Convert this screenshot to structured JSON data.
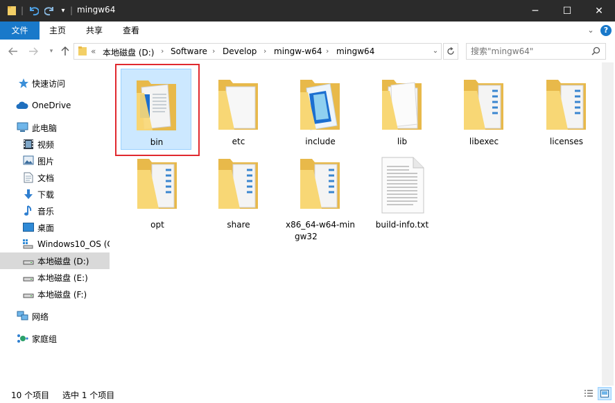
{
  "window": {
    "title": "mingw64",
    "buttons": {
      "minimize": "─",
      "maximize": "☐",
      "close": "✕"
    }
  },
  "ribbon": {
    "tabs": [
      {
        "label": "文件"
      },
      {
        "label": "主页"
      },
      {
        "label": "共享"
      },
      {
        "label": "查看"
      }
    ],
    "help_glyph": "?"
  },
  "address": {
    "prefix": "«",
    "crumbs": [
      "本地磁盘 (D:)",
      "Software",
      "Develop",
      "mingw-w64",
      "mingw64"
    ],
    "separator": "›"
  },
  "search": {
    "placeholder": "搜索\"mingw64\""
  },
  "sidebar": {
    "items": [
      {
        "label": "快速访问",
        "icon": "star-icon"
      },
      {
        "label": "OneDrive",
        "icon": "cloud-icon"
      },
      {
        "label": "此电脑",
        "icon": "computer-icon"
      },
      {
        "label": "视频",
        "icon": "video-icon"
      },
      {
        "label": "图片",
        "icon": "picture-icon"
      },
      {
        "label": "文档",
        "icon": "document-icon"
      },
      {
        "label": "下载",
        "icon": "download-icon"
      },
      {
        "label": "音乐",
        "icon": "music-icon"
      },
      {
        "label": "桌面",
        "icon": "desktop-icon"
      },
      {
        "label": "Windows10_OS (C",
        "icon": "drive-os-icon"
      },
      {
        "label": "本地磁盘 (D:)",
        "icon": "drive-icon"
      },
      {
        "label": "本地磁盘 (E:)",
        "icon": "drive-icon"
      },
      {
        "label": "本地磁盘 (F:)",
        "icon": "drive-icon"
      },
      {
        "label": "网络",
        "icon": "network-icon"
      },
      {
        "label": "家庭组",
        "icon": "homegroup-icon"
      }
    ]
  },
  "files": [
    {
      "name": "bin",
      "type": "folder",
      "selected": true
    },
    {
      "name": "etc",
      "type": "folder"
    },
    {
      "name": "include",
      "type": "folder"
    },
    {
      "name": "lib",
      "type": "folder"
    },
    {
      "name": "libexec",
      "type": "folder"
    },
    {
      "name": "licenses",
      "type": "folder"
    },
    {
      "name": "opt",
      "type": "folder"
    },
    {
      "name": "share",
      "type": "folder"
    },
    {
      "name": "x86_64-w64-mingw32",
      "name_lines": [
        "x86_64-w64-min",
        "gw32"
      ],
      "type": "folder"
    },
    {
      "name": "build-info.txt",
      "type": "text-file"
    }
  ],
  "status": {
    "item_count": "10 个项目",
    "selection": "选中 1 个项目"
  },
  "colors": {
    "accent": "#1979ca",
    "selection_bg": "#cce8ff",
    "selection_border": "#99d1ff",
    "highlight_box": "#e0282e",
    "folder": "#f8d775"
  }
}
